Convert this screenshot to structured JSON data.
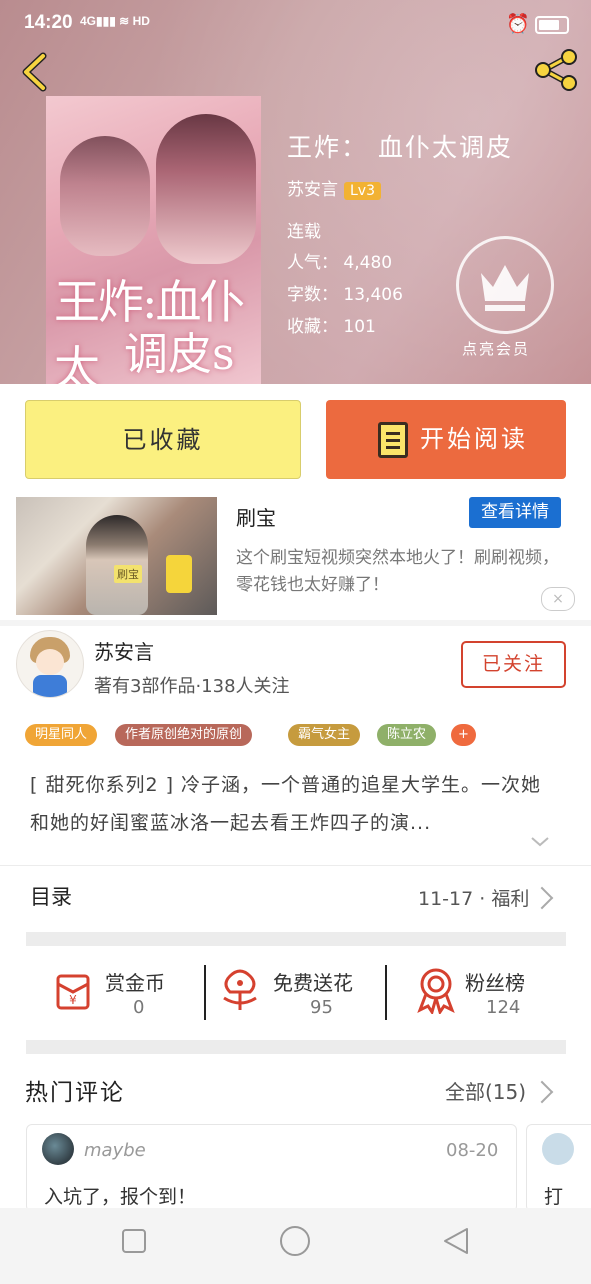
{
  "status_bar": {
    "time": "14:20",
    "network": "4G",
    "hd": "HD"
  },
  "book": {
    "title": "王炸： 血仆太调皮",
    "author": "苏安言",
    "level": "Lv3",
    "status": "连载",
    "popularity": "人气： 4,480",
    "word_count": "字数： 13,406",
    "favorites": "收藏： 101",
    "vip_label": "点亮会员",
    "cover_text_1": "王炸:血仆太",
    "cover_text_2": "调皮s"
  },
  "actions": {
    "favorited": "已收藏",
    "start_reading": "开始阅读"
  },
  "ad": {
    "title": "刷宝",
    "detail_button": "查看详情",
    "description": "这个刷宝短视频突然本地火了！刷刷视频，零花钱也太好赚了！",
    "thumb_tag": "刷宝",
    "close": "×"
  },
  "author_info": {
    "name": "苏安言",
    "stats": "著有3部作品·138人关注",
    "follow_button": "已关注"
  },
  "tags": [
    {
      "label": "明星同人",
      "color": "#f0a536"
    },
    {
      "label": "作者原创绝对的原创",
      "color": "#b8685a"
    },
    {
      "label": "霸气女主",
      "color": "#c69b3e"
    },
    {
      "label": "陈立农",
      "color": "#8fb069"
    },
    {
      "label": "+",
      "color": "#ef6a3e"
    }
  ],
  "summary": "[ 甜死你系列2 ] 冷子涵，一个普通的追星大学生。一次她和她的好闺蜜蓝冰洛一起去看王炸四子的演...",
  "toc": {
    "label": "目录",
    "latest": "11-17 · 福利"
  },
  "stats": [
    {
      "label": "赏金币",
      "value": "0",
      "icon": "red-envelope-icon"
    },
    {
      "label": "免费送花",
      "value": "95",
      "icon": "flower-icon"
    },
    {
      "label": "粉丝榜",
      "value": "124",
      "icon": "medal-icon"
    }
  ],
  "comments": {
    "title": "热门评论",
    "all_label": "全部(15)",
    "items": [
      {
        "user": "maybe",
        "date": "08-20",
        "text": "入坑了，报个到！"
      },
      {
        "text": "打"
      }
    ]
  }
}
